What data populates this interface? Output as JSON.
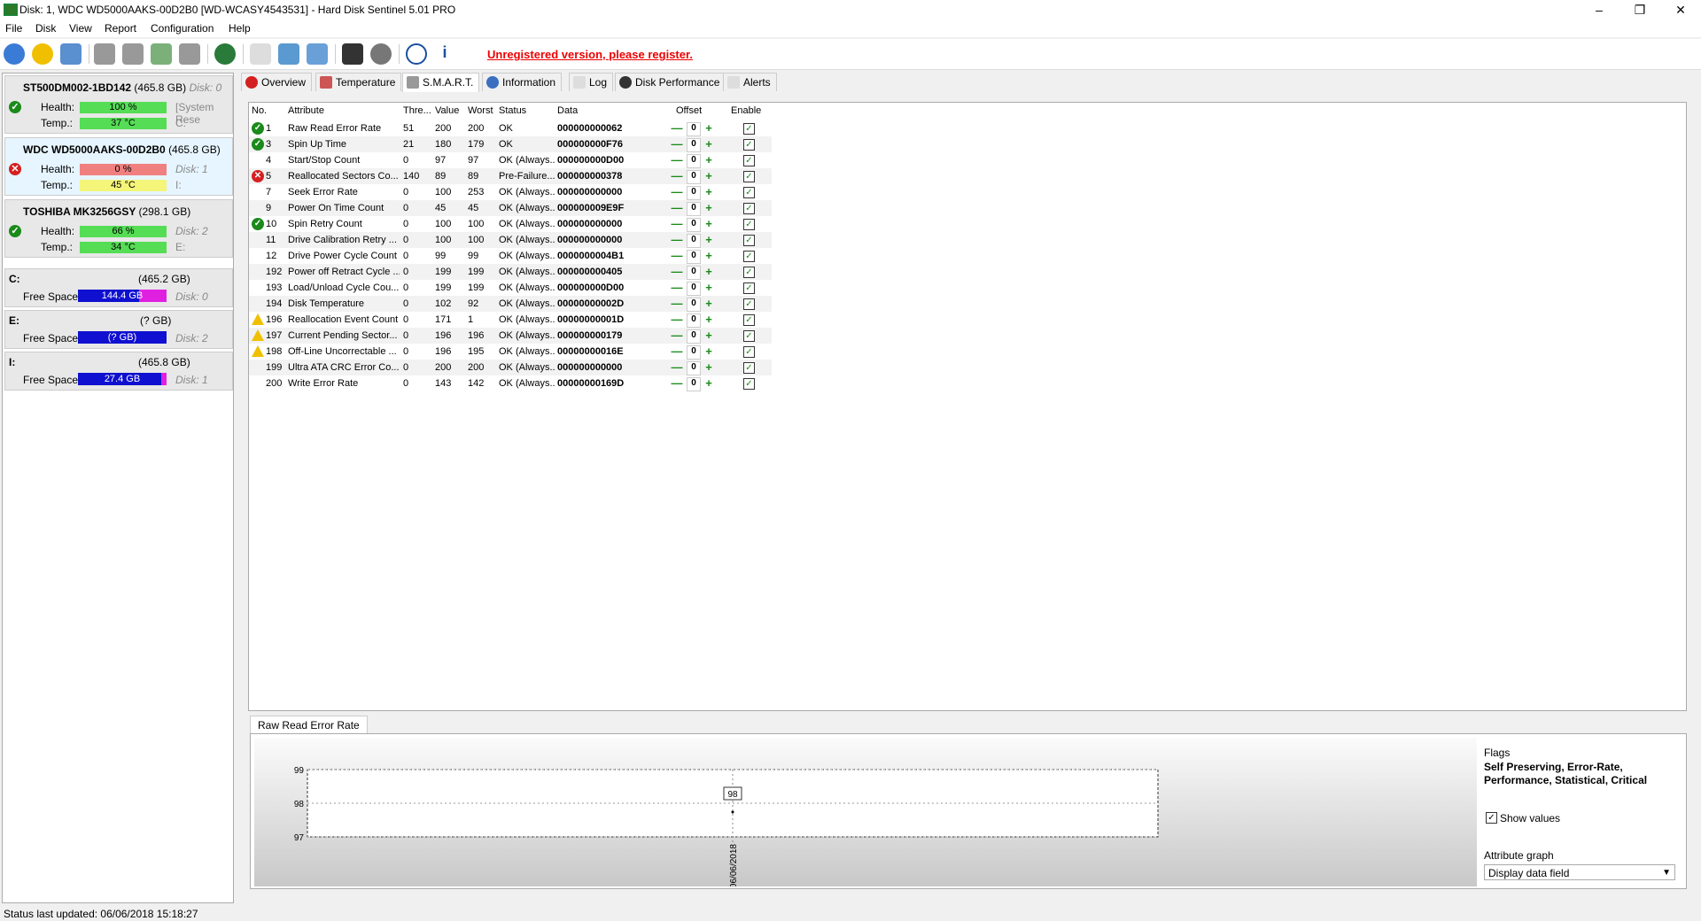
{
  "window": {
    "title": "Disk: 1, WDC WD5000AAKS-00D2B0 [WD-WCASY4543531]  -  Hard Disk Sentinel 5.01 PRO"
  },
  "menu": [
    "File",
    "Disk",
    "View",
    "Report",
    "Configuration",
    "Help"
  ],
  "toolbar": {
    "unregistered": "Unregistered version, please register."
  },
  "disks": [
    {
      "name": "ST500DM002-1BD142",
      "size": "(465.8 GB)",
      "disk": "Disk: 0",
      "health_label": "Health:",
      "health": "100 %",
      "health_pct": 100,
      "temp_label": "Temp.:",
      "temp": "37 °C",
      "extra1": "[System Rese",
      "extra2": "C:",
      "status": "ok",
      "health_color": "#55dd55",
      "temp_color": "#55dd55"
    },
    {
      "name": "WDC WD5000AAKS-00D2B0",
      "size": "(465.8 GB)",
      "disk": "Disk: 1",
      "health_label": "Health:",
      "health": "0 %",
      "health_pct": 100,
      "temp_label": "Temp.:",
      "temp": "45 °C",
      "extra1": "Disk: 1",
      "extra2": "I:",
      "status": "err",
      "health_color": "#f08080",
      "temp_color": "#f5f57a"
    },
    {
      "name": "TOSHIBA MK3256GSY",
      "size": "(298.1 GB)",
      "disk": "",
      "health_label": "Health:",
      "health": "66 %",
      "health_pct": 100,
      "temp_label": "Temp.:",
      "temp": "34 °C",
      "extra1": "Disk: 2",
      "extra2": "E:",
      "status": "ok",
      "health_color": "#55dd55",
      "temp_color": "#55dd55"
    }
  ],
  "volumes": [
    {
      "letter": "C:",
      "size": "(465.2 GB)",
      "free_label": "Free Space",
      "free": "144.4 GB",
      "used_fraction": 0.31,
      "disk": "Disk: 0"
    },
    {
      "letter": "E:",
      "size": "(? GB)",
      "free_label": "Free Space",
      "free": "(? GB)",
      "used_fraction": 0.0,
      "disk": "Disk: 2"
    },
    {
      "letter": "I:",
      "size": "(465.8 GB)",
      "free_label": "Free Space",
      "free": "27.4 GB",
      "used_fraction": 0.06,
      "disk": "Disk: 1"
    }
  ],
  "tabs": [
    "Overview",
    "Temperature",
    "S.M.A.R.T.",
    "Information",
    "Log",
    "Disk Performance",
    "Alerts"
  ],
  "smart": {
    "headers": [
      "No.",
      "Attribute",
      "Thre...",
      "Value",
      "Worst",
      "Status",
      "Data",
      "Offset",
      "Enable"
    ],
    "rows": [
      {
        "icon": "ok",
        "no": "1",
        "attr": "Raw Read Error Rate",
        "thr": "51",
        "val": "200",
        "worst": "200",
        "status": "OK",
        "data": "000000000062"
      },
      {
        "icon": "ok",
        "no": "3",
        "attr": "Spin Up Time",
        "thr": "21",
        "val": "180",
        "worst": "179",
        "status": "OK",
        "data": "000000000F76"
      },
      {
        "icon": "",
        "no": "4",
        "attr": "Start/Stop Count",
        "thr": "0",
        "val": "97",
        "worst": "97",
        "status": "OK (Always...",
        "data": "000000000D00"
      },
      {
        "icon": "err",
        "no": "5",
        "attr": "Reallocated Sectors Co...",
        "thr": "140",
        "val": "89",
        "worst": "89",
        "status": "Pre-Failure...",
        "data": "000000000378"
      },
      {
        "icon": "",
        "no": "7",
        "attr": "Seek Error Rate",
        "thr": "0",
        "val": "100",
        "worst": "253",
        "status": "OK (Always...",
        "data": "000000000000"
      },
      {
        "icon": "",
        "no": "9",
        "attr": "Power On Time Count",
        "thr": "0",
        "val": "45",
        "worst": "45",
        "status": "OK (Always...",
        "data": "000000009E9F"
      },
      {
        "icon": "ok",
        "no": "10",
        "attr": "Spin Retry Count",
        "thr": "0",
        "val": "100",
        "worst": "100",
        "status": "OK (Always...",
        "data": "000000000000"
      },
      {
        "icon": "",
        "no": "11",
        "attr": "Drive Calibration Retry ...",
        "thr": "0",
        "val": "100",
        "worst": "100",
        "status": "OK (Always...",
        "data": "000000000000"
      },
      {
        "icon": "",
        "no": "12",
        "attr": "Drive Power Cycle Count",
        "thr": "0",
        "val": "99",
        "worst": "99",
        "status": "OK (Always...",
        "data": "0000000004B1"
      },
      {
        "icon": "",
        "no": "192",
        "attr": "Power off Retract Cycle ...",
        "thr": "0",
        "val": "199",
        "worst": "199",
        "status": "OK (Always...",
        "data": "000000000405"
      },
      {
        "icon": "",
        "no": "193",
        "attr": "Load/Unload Cycle Cou...",
        "thr": "0",
        "val": "199",
        "worst": "199",
        "status": "OK (Always...",
        "data": "000000000D00"
      },
      {
        "icon": "",
        "no": "194",
        "attr": "Disk Temperature",
        "thr": "0",
        "val": "102",
        "worst": "92",
        "status": "OK (Always...",
        "data": "00000000002D"
      },
      {
        "icon": "warn",
        "no": "196",
        "attr": "Reallocation Event Count",
        "thr": "0",
        "val": "171",
        "worst": "1",
        "status": "OK (Always...",
        "data": "00000000001D"
      },
      {
        "icon": "warn",
        "no": "197",
        "attr": "Current Pending Sector...",
        "thr": "0",
        "val": "196",
        "worst": "196",
        "status": "OK (Always...",
        "data": "000000000179"
      },
      {
        "icon": "warn",
        "no": "198",
        "attr": "Off-Line Uncorrectable ...",
        "thr": "0",
        "val": "196",
        "worst": "195",
        "status": "OK (Always...",
        "data": "00000000016E"
      },
      {
        "icon": "",
        "no": "199",
        "attr": "Ultra ATA CRC Error Co...",
        "thr": "0",
        "val": "200",
        "worst": "200",
        "status": "OK (Always...",
        "data": "000000000000"
      },
      {
        "icon": "",
        "no": "200",
        "attr": "Write Error Rate",
        "thr": "0",
        "val": "143",
        "worst": "142",
        "status": "OK (Always...",
        "data": "00000000169D"
      }
    ],
    "offset_value": "0"
  },
  "graph": {
    "tab": "Raw Read Error Rate",
    "flags_label": "Flags",
    "flags": "Self Preserving, Error-Rate, Performance, Statistical, Critical",
    "show_values_label": "Show values",
    "attribute_graph_label": "Attribute graph",
    "attribute_graph_value": "Display data field"
  },
  "chart_data": {
    "type": "line",
    "x": [
      "06/06/2018"
    ],
    "series": [
      {
        "values": [
          98
        ]
      }
    ],
    "ylim": [
      97,
      99
    ],
    "yticks": [
      "99",
      "98",
      "97"
    ],
    "data_labels": [
      "98"
    ]
  },
  "status": {
    "text": "Status last updated: 06/06/2018 15:18:27"
  }
}
